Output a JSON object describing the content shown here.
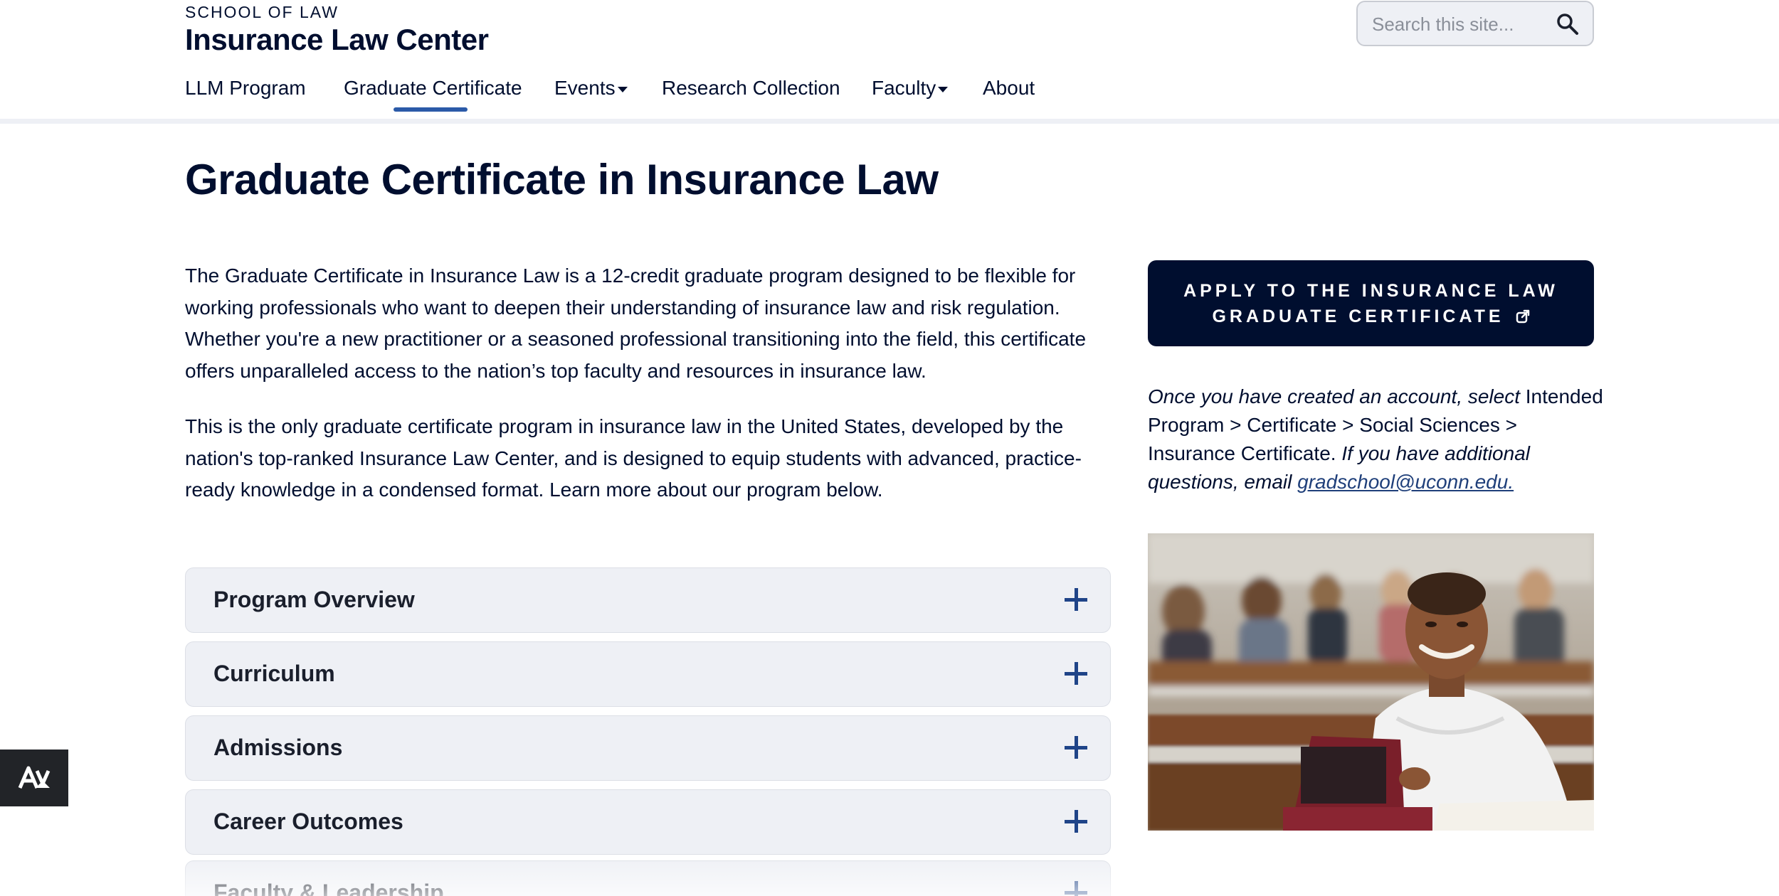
{
  "header": {
    "school": "SCHOOL OF LAW",
    "site_title": "Insurance Law Center",
    "search_placeholder": "Search this site..."
  },
  "nav": {
    "items": [
      {
        "label": "LLM Program",
        "dropdown": false
      },
      {
        "label": "Graduate Certificate",
        "dropdown": false,
        "active": true
      },
      {
        "label": "Events",
        "dropdown": true
      },
      {
        "label": "Research Collection",
        "dropdown": false
      },
      {
        "label": "Faculty",
        "dropdown": true
      },
      {
        "label": "About",
        "dropdown": false
      }
    ]
  },
  "main": {
    "title": "Graduate Certificate in Insurance Law",
    "paragraphs": [
      "The Graduate Certificate in Insurance Law is a 12-credit graduate program designed to be flexible for working professionals who want to deepen their understanding of insurance law and risk regulation. Whether you're a new practitioner or a seasoned professional transitioning into the field, this certificate offers unparalleled access to the nation’s top faculty and resources in insurance law.",
      "This is the only graduate certificate program in insurance law in the United States, developed by the nation's top-ranked Insurance Law Center, and is designed to equip students with advanced, practice-ready knowledge in a condensed format. Learn more about our program below."
    ],
    "accordion": [
      "Program Overview",
      "Curriculum",
      "Admissions",
      "Career Outcomes",
      "Faculty & Leadership"
    ]
  },
  "sidebar": {
    "apply_line1": "APPLY TO THE INSURANCE LAW",
    "apply_line2": "GRADUATE CERTIFICATE",
    "note_part1": "Once you have created an account, select",
    "note_part2": "Intended Program > Certificate > Social Sciences > Insurance Certificate.",
    "note_part3": "If you have additional questions, email",
    "note_email": "gradschool@uconn.edu."
  },
  "colors": {
    "navy": "#000e2f",
    "accent_blue": "#2b5aa8",
    "panel_gray": "#eef0f5"
  },
  "icons": [
    "search-icon",
    "external-link-icon",
    "plus-icon",
    "accessibility-icon"
  ]
}
